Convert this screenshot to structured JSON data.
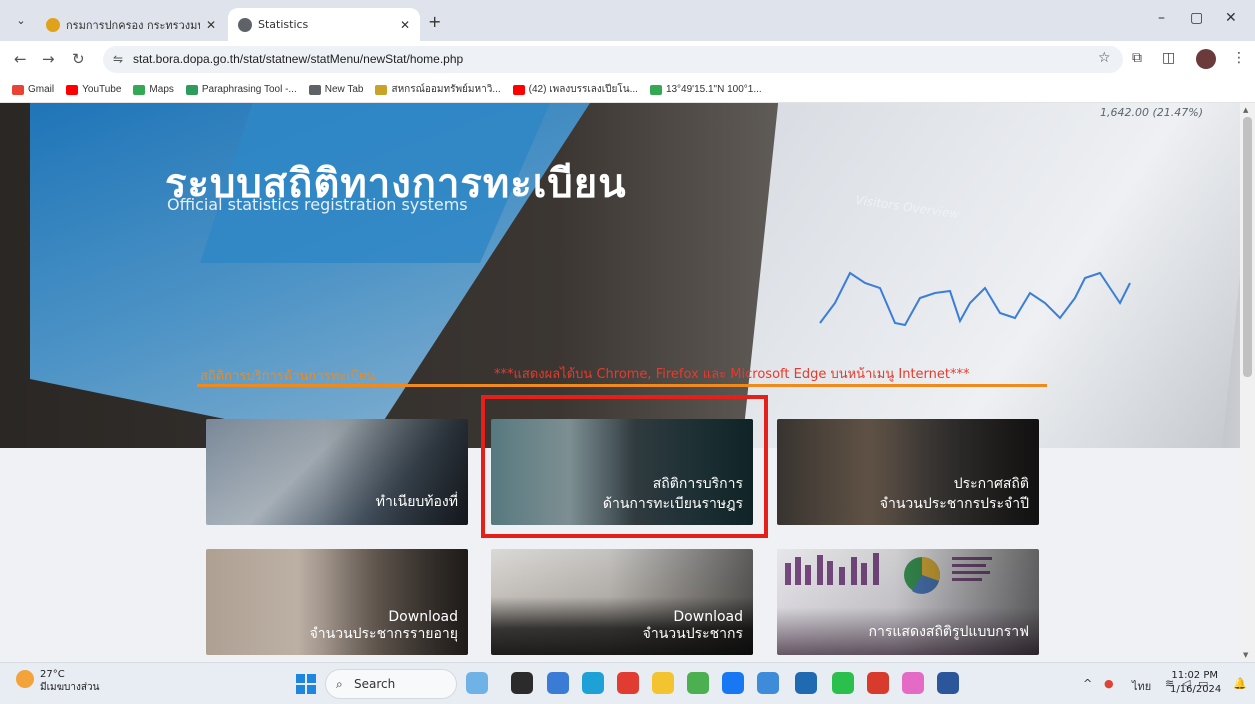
{
  "browser": {
    "tabs": [
      {
        "title": "กรมการปกครอง กระทรวงมหาดไทย",
        "active": false
      },
      {
        "title": "Statistics",
        "active": true
      }
    ],
    "url": "stat.bora.dopa.go.th/stat/statnew/statMenu/newStat/home.php",
    "bookmarks": [
      {
        "label": "Gmail",
        "color": "#ea4335"
      },
      {
        "label": "YouTube",
        "color": "#ff0000"
      },
      {
        "label": "Maps",
        "color": "#34a853"
      },
      {
        "label": "Paraphrasing Tool -...",
        "color": "#2e9c5b"
      },
      {
        "label": "New Tab",
        "color": "#5f6368"
      },
      {
        "label": "สหกรณ์ออมทรัพย์มหาวิ...",
        "color": "#c9a227"
      },
      {
        "label": "(42) เพลงบรรเลงเปียโน...",
        "color": "#ff0000"
      },
      {
        "label": "13°49'15.1\"N 100°1...",
        "color": "#34a853"
      }
    ]
  },
  "hero": {
    "title": "ระบบสถิติทางการทะเบียน",
    "subtitle": "Official statistics registration systems",
    "screen_chart_title": "Visitors Overview",
    "screen_donut_value": "1,642.00 (21.47%)"
  },
  "section": {
    "label": "สถิติการบริการด้านการทะเบียน",
    "notice": "***แสดงผลได้บน Chrome, Firefox และ Microsoft Edge บนหน้าเมนู Internet***"
  },
  "tiles": [
    {
      "line1": "ทำเนียบท้องที่",
      "line2": ""
    },
    {
      "line1": "สถิติการบริการ",
      "line2": "ด้านการทะเบียนราษฎร"
    },
    {
      "line1": "ประกาศสถิติ",
      "line2": "จำนวนประชากรประจำปี"
    },
    {
      "line1": "Download",
      "line2": "จำนวนประชากรรายอายุ"
    },
    {
      "line1": "Download",
      "line2": "จำนวนประชากร"
    },
    {
      "line1": "การแสดงสถิติรูปแบบกราฟ",
      "line2": ""
    }
  ],
  "taskbar": {
    "weather_temp": "27°C",
    "weather_desc": "มีเมฆบางส่วน",
    "search": "Search",
    "lang": "ไทย",
    "time": "11:02 PM",
    "date": "1/16/2024"
  },
  "colors": {
    "accent_orange": "#f08a1c",
    "notice_red": "#e53b2c",
    "highlight_red": "#e5201a"
  }
}
